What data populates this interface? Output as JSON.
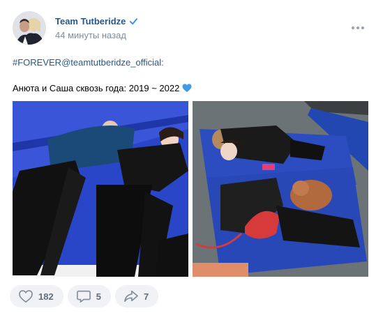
{
  "post": {
    "author": "Team Tutberidze",
    "timestamp": "44 минуты назад",
    "hashtag": "#FOREVER",
    "mention": "@teamtutberidze_official",
    "mention_suffix": ":",
    "caption": "Анюта и Саша сквозь года: 2019 ~ 2022",
    "emoji": "blue-heart"
  },
  "actions": {
    "likes": "182",
    "comments": "5",
    "shares": "7"
  },
  "colors": {
    "link": "#2a5885",
    "muted": "#818c99",
    "verified": "#3f8ae0",
    "button_bg": "#f0f2f5"
  },
  "icons": [
    "verified-icon",
    "more-icon",
    "like-icon",
    "comment-icon",
    "share-icon",
    "blue-heart-icon"
  ]
}
